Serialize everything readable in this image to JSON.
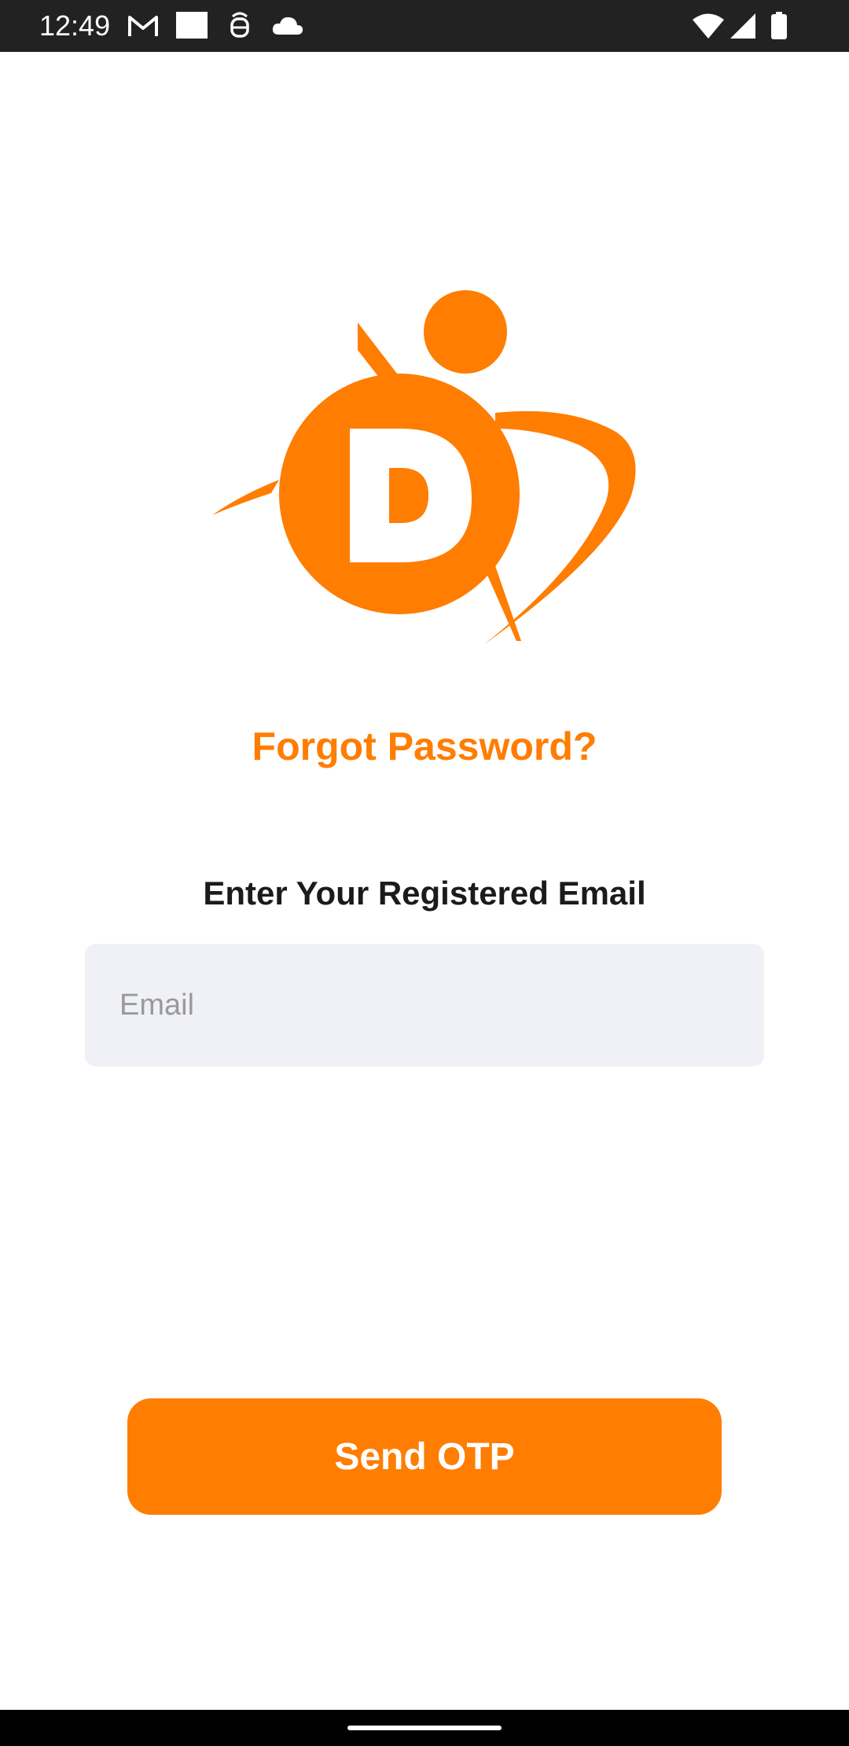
{
  "status_bar": {
    "time": "12:49",
    "icons": [
      "gmail-icon",
      "square-notification-icon",
      "android-debug-icon",
      "cloud-icon",
      "wifi-icon",
      "signal-icon",
      "battery-icon"
    ]
  },
  "logo": {
    "letter": "D",
    "brand_color": "#FF7D00"
  },
  "page": {
    "title": "Forgot Password?",
    "subtitle": "Enter Your Registered Email"
  },
  "form": {
    "email_placeholder": "Email",
    "email_value": "",
    "submit_label": "Send OTP"
  },
  "colors": {
    "accent": "#FF7D00",
    "field_background": "#F0F1F6",
    "status_bar": "#222222"
  }
}
